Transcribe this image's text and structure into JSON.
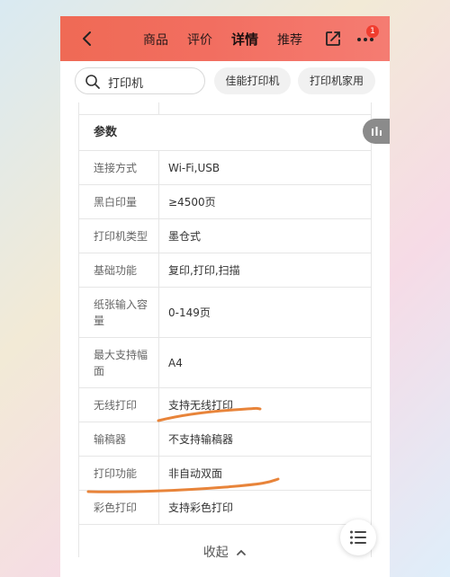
{
  "header": {
    "tabs": [
      {
        "label": "商品"
      },
      {
        "label": "评价"
      },
      {
        "label": "详情"
      },
      {
        "label": "推荐"
      }
    ],
    "notification_count": "1",
    "accent_color": "#f26e60"
  },
  "search": {
    "value": "打印机",
    "suggestions": [
      "佳能打印机",
      "打印机家用"
    ]
  },
  "specs": {
    "section_title": "参数",
    "rows": [
      {
        "key": "连接方式",
        "value": "Wi-Fi,USB"
      },
      {
        "key": "黑白印量",
        "value": "≥4500页"
      },
      {
        "key": "打印机类型",
        "value": "墨仓式"
      },
      {
        "key": "基础功能",
        "value": "复印,打印,扫描"
      },
      {
        "key": "纸张输入容量",
        "value": "0-149页"
      },
      {
        "key": "最大支持幅面",
        "value": "A4"
      },
      {
        "key": "无线打印",
        "value": "支持无线打印"
      },
      {
        "key": "输稿器",
        "value": "不支持输稿器"
      },
      {
        "key": "打印功能",
        "value": "非自动双面"
      },
      {
        "key": "彩色打印",
        "value": "支持彩色打印"
      }
    ]
  },
  "footer": {
    "collapse_label": "收起"
  },
  "annotation_color": "#e8843a"
}
